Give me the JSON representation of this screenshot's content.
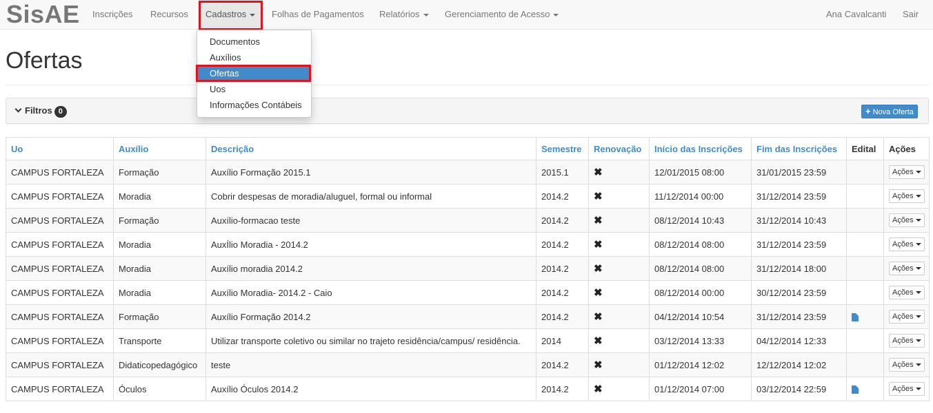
{
  "brand": "SisAE",
  "nav": {
    "inscricoes": "Inscrições",
    "recursos": "Recursos",
    "cadastros": "Cadastros",
    "folhas": "Folhas de Pagamentos",
    "relatorios": "Relatórios",
    "gerenciamento": "Gerenciamento de Acesso",
    "user": "Ana Cavalcanti",
    "sair": "Sair"
  },
  "dropdown": {
    "items": [
      "Documentos",
      "Auxílios",
      "Ofertas",
      "Uos",
      "Informações Contábeis"
    ],
    "selected": "Ofertas"
  },
  "page_title": "Ofertas",
  "filters": {
    "label": "Filtros",
    "count": "0"
  },
  "new_button": "Nova Oferta",
  "table": {
    "headers": {
      "uo": "Uo",
      "auxilio": "Auxílio",
      "descricao": "Descrição",
      "semestre": "Semestre",
      "renovacao": "Renovação",
      "inicio": "Início das Inscrições",
      "fim": "Fim das Inscrições",
      "edital": "Edital",
      "acoes": "Ações"
    },
    "renovacao_glyph": "✖",
    "action_label": "Ações",
    "rows": [
      {
        "uo": "CAMPUS FORTALEZA",
        "auxilio": "Formação",
        "descricao": "Auxílio Formação 2015.1",
        "semestre": "2015.1",
        "inicio": "12/01/2015 08:00",
        "fim": "31/01/2015 23:59",
        "edital": false
      },
      {
        "uo": "CAMPUS FORTALEZA",
        "auxilio": "Moradia",
        "descricao": "Cobrir despesas de moradia/aluguel, formal ou informal",
        "semestre": "2014.2",
        "inicio": "11/12/2014 00:00",
        "fim": "31/12/2014 23:59",
        "edital": false
      },
      {
        "uo": "CAMPUS FORTALEZA",
        "auxilio": "Formação",
        "descricao": "Auxílio-formacao teste",
        "semestre": "2014.2",
        "inicio": "08/12/2014 10:43",
        "fim": "31/12/2014 10:43",
        "edital": false
      },
      {
        "uo": "CAMPUS FORTALEZA",
        "auxilio": "Moradia",
        "descricao": "AuxÍlio Moradia - 2014.2",
        "semestre": "2014.2",
        "inicio": "08/12/2014 08:00",
        "fim": "31/12/2014 23:59",
        "edital": false
      },
      {
        "uo": "CAMPUS FORTALEZA",
        "auxilio": "Moradia",
        "descricao": "Auxílio moradia 2014.2",
        "semestre": "2014.2",
        "inicio": "08/12/2014 08:00",
        "fim": "31/12/2014 18:00",
        "edital": false
      },
      {
        "uo": "CAMPUS FORTALEZA",
        "auxilio": "Moradia",
        "descricao": "Auxílio Moradia- 2014.2 - Caio",
        "semestre": "2014.2",
        "inicio": "08/12/2014 00:00",
        "fim": "30/12/2014 23:59",
        "edital": false
      },
      {
        "uo": "CAMPUS FORTALEZA",
        "auxilio": "Formação",
        "descricao": "Auxílio Formação 2014.2",
        "semestre": "2014.2",
        "inicio": "04/12/2014 10:54",
        "fim": "31/12/2014 23:59",
        "edital": true
      },
      {
        "uo": "CAMPUS FORTALEZA",
        "auxilio": "Transporte",
        "descricao": "Utilizar transporte coletivo ou similar no trajeto residência/campus/ residência.",
        "semestre": "2014",
        "inicio": "03/12/2014 13:33",
        "fim": "04/12/2014 12:33",
        "edital": false
      },
      {
        "uo": "CAMPUS FORTALEZA",
        "auxilio": "Didaticopedagógico",
        "descricao": "teste",
        "semestre": "2014.2",
        "inicio": "01/12/2014 12:02",
        "fim": "12/12/2014 12:02",
        "edital": false
      },
      {
        "uo": "CAMPUS FORTALEZA",
        "auxilio": "Óculos",
        "descricao": "Auxílio Óculos 2014.2",
        "semestre": "2014.2",
        "inicio": "01/12/2014 07:00",
        "fim": "03/12/2014 22:59",
        "edital": true
      }
    ]
  },
  "colors": {
    "accent": "#428bca",
    "highlight": "#e1141e",
    "navbar_bg": "#f8f8f8"
  }
}
